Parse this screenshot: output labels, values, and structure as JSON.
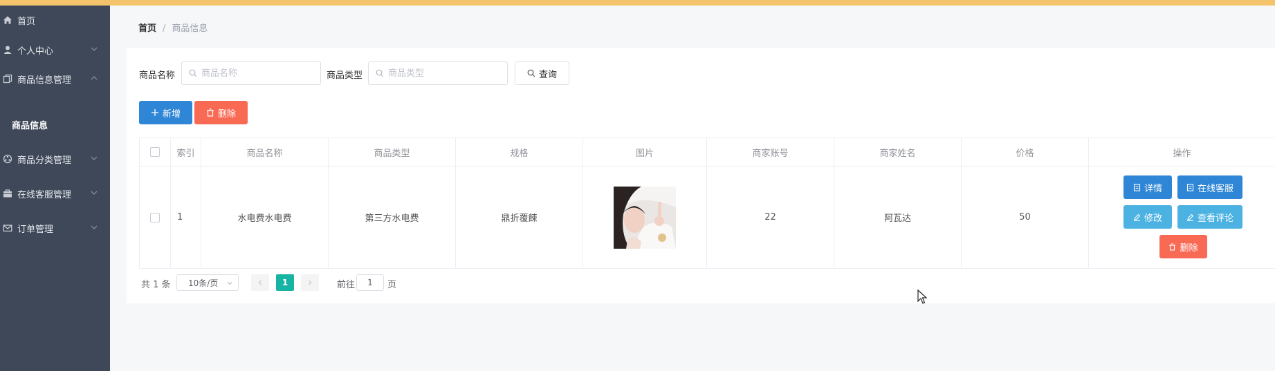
{
  "sidebar": {
    "items": [
      {
        "label": "首页",
        "icon": "home-icon"
      },
      {
        "label": "个人中心",
        "icon": "user-icon"
      },
      {
        "label": "商品信息管理",
        "icon": "copy-icon"
      },
      {
        "label": "商品分类管理",
        "icon": "category-icon"
      },
      {
        "label": "在线客服管理",
        "icon": "briefcase-icon"
      },
      {
        "label": "订单管理",
        "icon": "mail-icon"
      }
    ],
    "sub_item": "商品信息"
  },
  "breadcrumb": {
    "home": "首页",
    "separator": "/",
    "current": "商品信息"
  },
  "search": {
    "name_label": "商品名称",
    "name_placeholder": "商品名称",
    "type_label": "商品类型",
    "type_placeholder": "商品类型",
    "query_label": "查询"
  },
  "toolbar": {
    "add_label": "新增",
    "delete_label": "删除"
  },
  "table": {
    "columns": [
      "索引",
      "商品名称",
      "商品类型",
      "规格",
      "图片",
      "商家账号",
      "商家姓名",
      "价格",
      "操作"
    ],
    "rows": [
      {
        "index": "1",
        "name": "水电费水电费",
        "type": "第三方水电费",
        "spec": "鼎折覆餗",
        "account": "22",
        "merchant": "阿瓦达",
        "price": "50"
      }
    ],
    "row_actions": {
      "detail": "详情",
      "service": "在线客服",
      "edit": "修改",
      "reviews": "查看评论",
      "delete": "删除"
    }
  },
  "pagination": {
    "total": "共 1 条",
    "page_size": "10条/页",
    "current_page": "1",
    "goto_prefix": "前往",
    "goto_value": "1",
    "goto_suffix": "页"
  },
  "colors": {
    "primary": "#2f86d6",
    "danger": "#f96a55",
    "info": "#4cb2e2",
    "accent": "#17b3a3",
    "sidebar": "#3e4858"
  }
}
